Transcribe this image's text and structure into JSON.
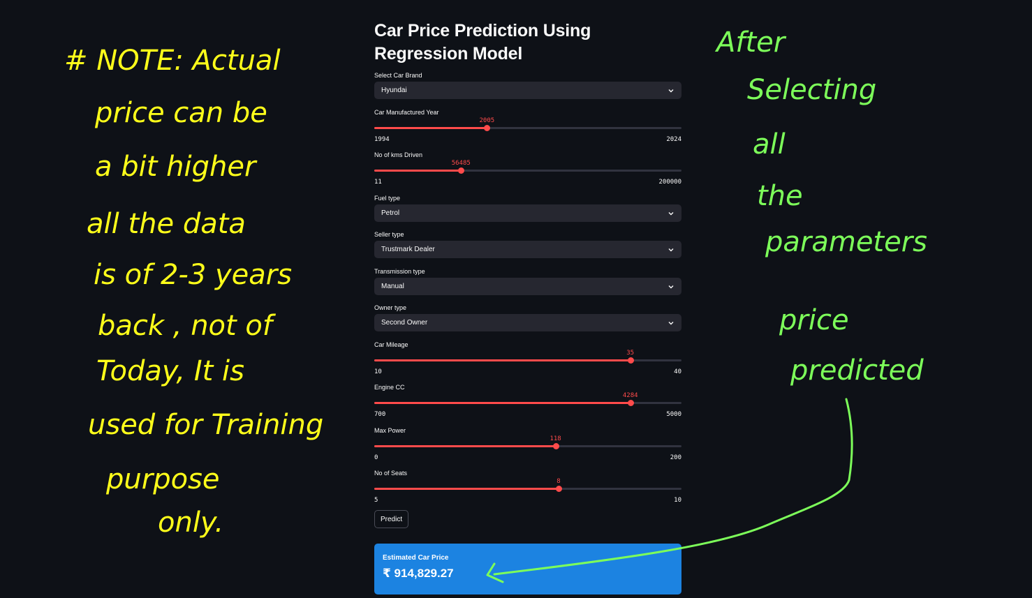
{
  "app": {
    "title": "Car Price Prediction Using Regression Model"
  },
  "fields": {
    "brand": {
      "label": "Select Car Brand",
      "value": "Hyundai"
    },
    "year": {
      "label": "Car Manufactured Year",
      "min": "1994",
      "max": "2024",
      "value": "2005",
      "min_num": 1994,
      "max_num": 2024,
      "value_num": 2005
    },
    "kms": {
      "label": "No of kms Driven",
      "min": "11",
      "max": "200000",
      "value": "56485",
      "min_num": 11,
      "max_num": 200000,
      "value_num": 56485
    },
    "fuel": {
      "label": "Fuel type",
      "value": "Petrol"
    },
    "seller": {
      "label": "Seller type",
      "value": "Trustmark Dealer"
    },
    "transmission": {
      "label": "Transmission type",
      "value": "Manual"
    },
    "owner": {
      "label": "Owner type",
      "value": "Second Owner"
    },
    "mileage": {
      "label": "Car Mileage",
      "min": "10",
      "max": "40",
      "value": "35",
      "min_num": 10,
      "max_num": 40,
      "value_num": 35
    },
    "engine": {
      "label": "Engine CC",
      "min": "700",
      "max": "5000",
      "value": "4284",
      "min_num": 700,
      "max_num": 5000,
      "value_num": 4284
    },
    "power": {
      "label": "Max Power",
      "min": "0",
      "max": "200",
      "value": "118",
      "min_num": 0,
      "max_num": 200,
      "value_num": 118
    },
    "seats": {
      "label": "No of Seats",
      "min": "5",
      "max": "10",
      "value": "8",
      "min_num": 5,
      "max_num": 10,
      "value_num": 8
    }
  },
  "predict_button": "Predict",
  "result": {
    "title": "Estimated Car Price",
    "value": "₹ 914,829.27"
  },
  "annotations": {
    "left_note": [
      "# NOTE: Actual",
      "price can be",
      "a bit higher",
      "all the data",
      "is of 2-3 years",
      "back , not of",
      "Today, It is",
      "used for Training",
      "purpose",
      "only."
    ],
    "right_note": [
      "After",
      "Selecting",
      "all",
      "the",
      "parameters",
      "price",
      "predicted"
    ]
  },
  "colors": {
    "background": "#0e1117",
    "accent": "#ff4b4b",
    "widget_bg": "#262730",
    "result_bg": "#1c83e1",
    "note_yellow": "#ffff1a",
    "note_green": "#7dff5a"
  },
  "icons": {
    "select_chevron": "chevron-down-icon"
  }
}
